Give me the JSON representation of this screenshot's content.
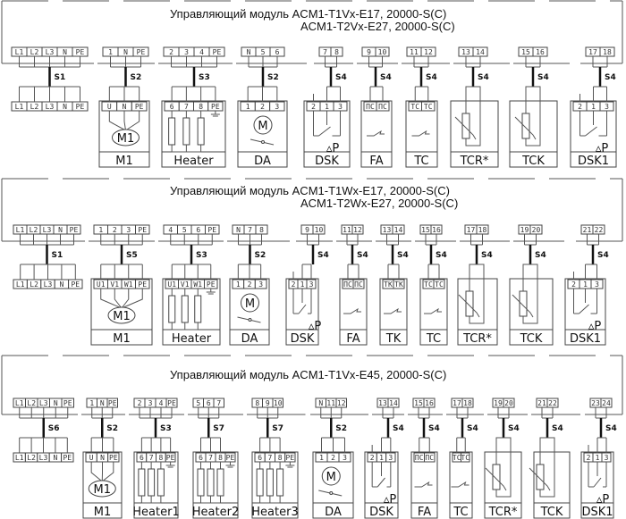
{
  "panels": [
    {
      "title": [
        "Управляющий модуль  ACM1-T1Vx-E17, 20000-S(C)",
        "ACM1-T2Vx-E27, 20000-S(C)"
      ],
      "blocks": [
        {
          "type": "power",
          "top": [
            "L1",
            "L2",
            "L3",
            "N",
            "PE"
          ],
          "cable": "S1",
          "bottom": [
            "L1",
            "L2",
            "L3",
            "N",
            "PE"
          ],
          "label": ""
        },
        {
          "type": "motor",
          "top": [
            "1",
            "N",
            "PE"
          ],
          "cable": "S2",
          "bottom": [
            "U",
            "N",
            "PE"
          ],
          "label": "M1",
          "symbol": "M1"
        },
        {
          "type": "heater",
          "top": [
            "2",
            "3",
            "4",
            "PE"
          ],
          "cable": "S3",
          "bottom": [
            "6",
            "7",
            "8",
            "PE"
          ],
          "label": "Heater"
        },
        {
          "type": "damper",
          "top": [
            "N",
            "5",
            "6"
          ],
          "cable": "S2",
          "bottom": [
            "1",
            "2",
            "3"
          ],
          "label": "DA",
          "symbol": "M"
        },
        {
          "type": "pressure",
          "top": [
            "7",
            "8"
          ],
          "cable": "S4",
          "bottom": [
            "2",
            "1",
            "3"
          ],
          "label": "DSK",
          "symbol": "P"
        },
        {
          "type": "switch",
          "top": [
            "9",
            "10"
          ],
          "cable": "S4",
          "bottom": [
            "ПС",
            "ПС"
          ],
          "label": "FA"
        },
        {
          "type": "switch",
          "top": [
            "11",
            "12"
          ],
          "cable": "S4",
          "bottom": [
            "ТС",
            "ТС"
          ],
          "label": "TC"
        },
        {
          "type": "sensor",
          "top": [
            "13",
            "14"
          ],
          "cable": "S4",
          "bottom": [],
          "label": "TCR*"
        },
        {
          "type": "sensor",
          "top": [
            "15",
            "16"
          ],
          "cable": "S4",
          "bottom": [],
          "label": "TCK"
        },
        {
          "type": "pressure",
          "top": [
            "17",
            "18"
          ],
          "cable": "S4",
          "bottom": [
            "2",
            "1",
            "3"
          ],
          "label": "DSK1",
          "symbol": "P"
        }
      ]
    },
    {
      "title": [
        "Управляющий модуль  ACM1-T1Wx-E17, 20000-S(C)",
        "ACM1-T2Wx-E27, 20000-S(C)"
      ],
      "blocks": [
        {
          "type": "power",
          "top": [
            "L1",
            "L2",
            "L3",
            "N",
            "PE"
          ],
          "cable": "S1",
          "bottom": [
            "L1",
            "L2",
            "L3",
            "N",
            "PE"
          ],
          "label": ""
        },
        {
          "type": "motor",
          "top": [
            "1",
            "2",
            "3",
            "PE"
          ],
          "cable": "S5",
          "bottom": [
            "U1",
            "V1",
            "W1",
            "PE"
          ],
          "label": "M1",
          "symbol": "M1"
        },
        {
          "type": "heater",
          "top": [
            "4",
            "5",
            "6",
            "PE"
          ],
          "cable": "S3",
          "bottom": [
            "U1",
            "V1",
            "W1",
            "PE"
          ],
          "label": "Heater"
        },
        {
          "type": "damper",
          "top": [
            "N",
            "7",
            "8"
          ],
          "cable": "S2",
          "bottom": [
            "1",
            "2",
            "3"
          ],
          "label": "DA",
          "symbol": "M"
        },
        {
          "type": "pressure",
          "top": [
            "9",
            "10"
          ],
          "cable": "S4",
          "bottom": [
            "2",
            "1",
            "3"
          ],
          "label": "DSK",
          "symbol": "P"
        },
        {
          "type": "switch",
          "top": [
            "11",
            "12"
          ],
          "cable": "S4",
          "bottom": [
            "ПС",
            "ПС"
          ],
          "label": "FA"
        },
        {
          "type": "switch",
          "top": [
            "13",
            "14"
          ],
          "cable": "S4",
          "bottom": [
            "ТК",
            "ТК"
          ],
          "label": "TK"
        },
        {
          "type": "switch",
          "top": [
            "15",
            "16"
          ],
          "cable": "S4",
          "bottom": [
            "ТС",
            "ТС"
          ],
          "label": "TC"
        },
        {
          "type": "sensor",
          "top": [
            "17",
            "18"
          ],
          "cable": "S4",
          "bottom": [],
          "label": "TCR*"
        },
        {
          "type": "sensor",
          "top": [
            "19",
            "20"
          ],
          "cable": "S4",
          "bottom": [],
          "label": "TCK"
        },
        {
          "type": "pressure",
          "top": [
            "21",
            "22"
          ],
          "cable": "S4",
          "bottom": [
            "2",
            "1",
            "3"
          ],
          "label": "DSK1",
          "symbol": "P"
        }
      ]
    },
    {
      "title": [
        "Управляющий модуль  ACM1-T1Vx-E45, 20000-S(C)"
      ],
      "blocks": [
        {
          "type": "power",
          "top": [
            "L1",
            "L2",
            "L3",
            "N",
            "PE"
          ],
          "cable": "S6",
          "bottom": [
            "L1",
            "L2",
            "L3",
            "N",
            "PE"
          ],
          "label": ""
        },
        {
          "type": "motor",
          "top": [
            "1",
            "N",
            "PE"
          ],
          "cable": "S2",
          "bottom": [
            "U",
            "N",
            "PE"
          ],
          "label": "M1",
          "symbol": "M1"
        },
        {
          "type": "heater",
          "top": [
            "2",
            "3",
            "4",
            "PE"
          ],
          "cable": "S3",
          "bottom": [
            "6",
            "7",
            "8",
            "PE"
          ],
          "label": "Heater1"
        },
        {
          "type": "heater",
          "top": [
            "5",
            "6",
            "7"
          ],
          "cable": "S7",
          "bottom": [
            "6",
            "7",
            "8",
            "PE"
          ],
          "label": "Heater2"
        },
        {
          "type": "heater",
          "top": [
            "8",
            "9",
            "10"
          ],
          "cable": "S7",
          "bottom": [
            "6",
            "7",
            "8",
            "PE"
          ],
          "label": "Heater3"
        },
        {
          "type": "damper",
          "top": [
            "N",
            "11",
            "12"
          ],
          "cable": "S2",
          "bottom": [
            "1",
            "2",
            "3"
          ],
          "label": "DA",
          "symbol": "M"
        },
        {
          "type": "pressure",
          "top": [
            "13",
            "14"
          ],
          "cable": "S4",
          "bottom": [
            "2",
            "1",
            "3"
          ],
          "label": "DSK",
          "symbol": "P"
        },
        {
          "type": "switch",
          "top": [
            "15",
            "16"
          ],
          "cable": "S4",
          "bottom": [
            "ПС",
            "ПС"
          ],
          "label": "FA"
        },
        {
          "type": "switch",
          "top": [
            "17",
            "18"
          ],
          "cable": "S4",
          "bottom": [
            "ТС",
            "ТС"
          ],
          "label": "TC"
        },
        {
          "type": "sensor",
          "top": [
            "19",
            "20"
          ],
          "cable": "S4",
          "bottom": [],
          "label": "TCR*"
        },
        {
          "type": "sensor",
          "top": [
            "21",
            "22"
          ],
          "cable": "S4",
          "bottom": [],
          "label": "TCK"
        },
        {
          "type": "pressure",
          "top": [
            "23",
            "24"
          ],
          "cable": "S4",
          "bottom": [
            "2",
            "1",
            "3"
          ],
          "label": "DSK1",
          "symbol": "P"
        }
      ]
    }
  ]
}
